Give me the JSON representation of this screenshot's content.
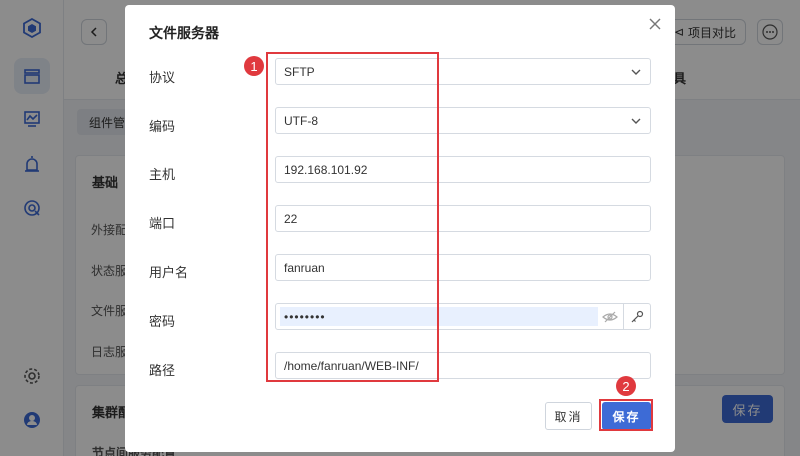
{
  "background": {
    "tabs": [
      "总",
      "具"
    ],
    "compare_button": "项目对比",
    "sub_tab": "组件管",
    "panel1_title": "基础",
    "panel1_items": [
      "外接配",
      "状态服",
      "文件服",
      "日志服"
    ],
    "panel2_title": "集群配",
    "panel2_partial": "节点间服务配置",
    "save_label": "保存"
  },
  "dialog": {
    "title": "文件服务器",
    "fields": {
      "protocol_label": "协议",
      "protocol_value": "SFTP",
      "encoding_label": "编码",
      "encoding_value": "UTF-8",
      "host_label": "主机",
      "host_value": "192.168.101.92",
      "port_label": "端口",
      "port_value": "22",
      "user_label": "用户名",
      "user_value": "fanruan",
      "password_label": "密码",
      "password_value": "••••••••",
      "path_label": "路径",
      "path_value": "/home/fanruan/WEB-INF/"
    },
    "cancel_label": "取消",
    "save_label": "保存"
  },
  "annotations": {
    "badge1": "1",
    "badge2": "2"
  },
  "colors": {
    "primary": "#3d6bd6",
    "annotation_red": "#e0393e"
  }
}
